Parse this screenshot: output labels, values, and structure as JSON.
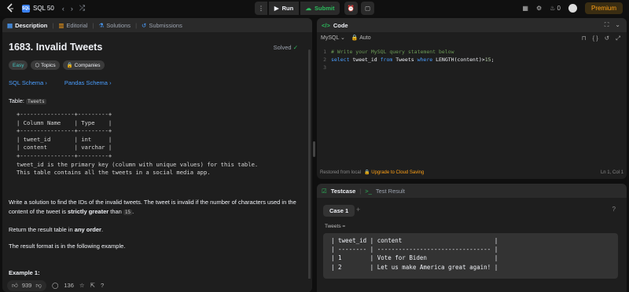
{
  "topbar": {
    "list_name": "SQL 50",
    "run_label": "Run",
    "submit_label": "Submit",
    "streak_count": "0",
    "premium_label": "Premium"
  },
  "left": {
    "tabs": [
      "Description",
      "Editorial",
      "Solutions",
      "Submissions"
    ],
    "title": "1683. Invalid Tweets",
    "solved_label": "Solved",
    "chips": [
      "Easy",
      "Topics",
      "Companies"
    ],
    "schema_links": [
      "SQL Schema",
      "Pandas Schema"
    ],
    "table_label": "Table:",
    "table_name": "Tweets",
    "schema_text": "+----------------+---------+\n| Column Name    | Type    |\n+----------------+---------+\n| tweet_id       | int     |\n| content        | varchar |\n+----------------+---------+\ntweet_id is the primary key (column with unique values) for this table.\nThis table contains all the tweets in a social media app.",
    "p1_a": "Write a solution to find the IDs of the invalid tweets. The tweet is invalid if the number of characters used in the content of the tweet is ",
    "p1_bold": "strictly greater",
    "p1_b": " than ",
    "p1_code": "15",
    "p1_end": ".",
    "p2_a": "Return the result table in ",
    "p2_bold": "any order",
    "p2_end": ".",
    "p3": "The result format is in the following example.",
    "example_label": "Example 1:",
    "likes": "939",
    "comments": "136"
  },
  "code": {
    "tab_label": "Code",
    "language": "MySQL",
    "auto_label": "Auto",
    "lines": [
      {
        "n": "1",
        "comment": "# Write your MySQL query statement below"
      },
      {
        "n": "2",
        "k1": "select",
        "t1": " tweet_id ",
        "k2": "from",
        "t2": " Tweets ",
        "k3": "where",
        "t3": " LENGTH(content)>",
        "num": "15",
        "t4": ";"
      },
      {
        "n": "3"
      }
    ],
    "restored": "Restored from local",
    "upgrade": "Upgrade to Cloud Saving",
    "position": "Ln 1, Col 1"
  },
  "test": {
    "tabs": [
      "Testcase",
      "Test Result"
    ],
    "case_label": "Case 1",
    "table_label": "Tweets =",
    "table_text": "| tweet_id | content                          |\n| -------- | -------------------------------- |\n| 1        | Vote for Biden                   |\n| 2        | Let us make America great again! |"
  }
}
